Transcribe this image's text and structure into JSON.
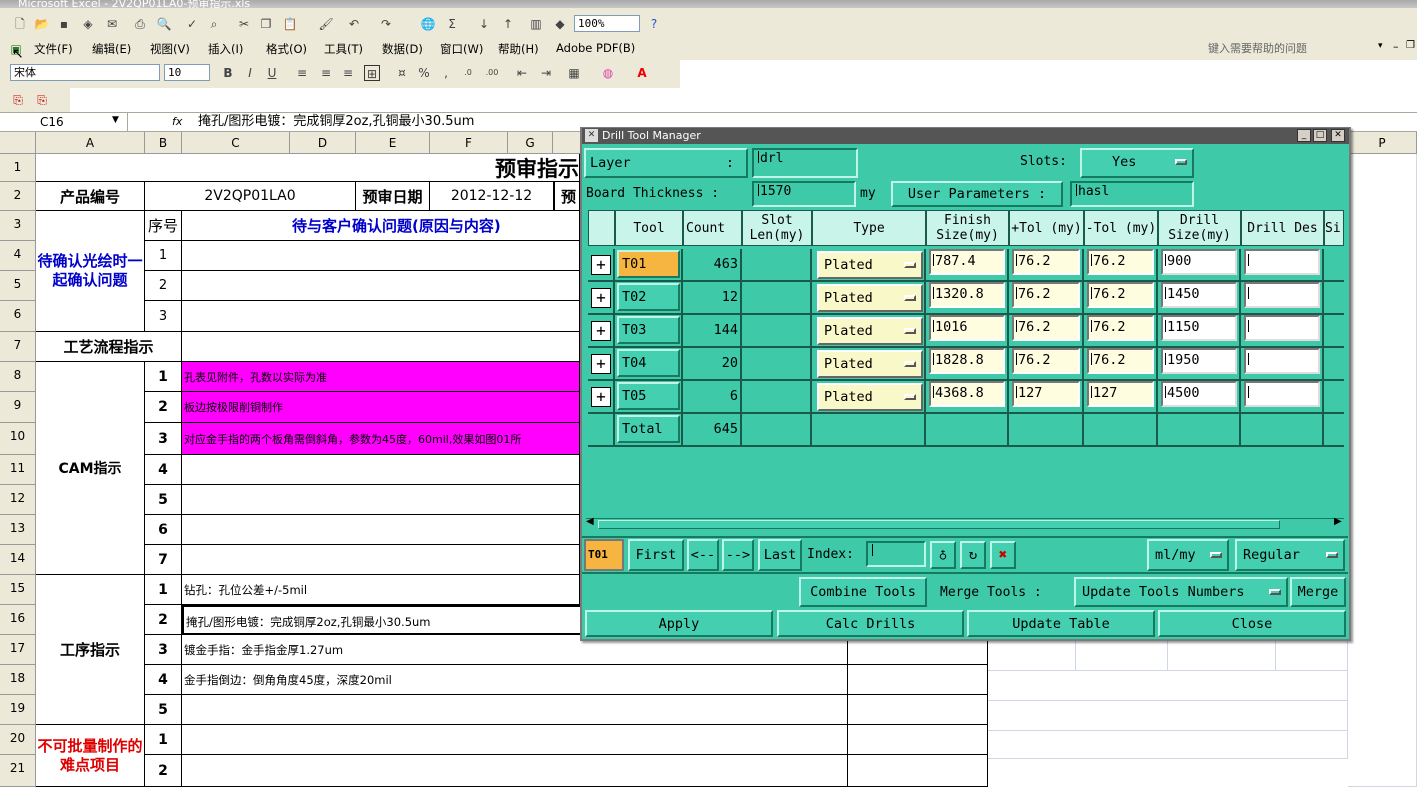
{
  "window_title": "Microsoft Excel - 2V2QP01LA0-预审指示.xls",
  "menu": [
    "文件(F)",
    "编辑(E)",
    "视图(V)",
    "插入(I)",
    "格式(O)",
    "工具(T)",
    "数据(D)",
    "窗口(W)",
    "帮助(H)",
    "Adobe PDF(B)"
  ],
  "help_placeholder": "键入需要帮助的问题",
  "zoom": "100%",
  "font_name": "宋体",
  "font_size": "10",
  "name_box": "C16",
  "fx_label": "fx",
  "formula": "掩孔/图形电镀：完成铜厚2oz,孔铜最小30.5um",
  "columns": [
    "A",
    "B",
    "C",
    "D",
    "E",
    "F",
    "G",
    "P"
  ],
  "rows": [
    "1",
    "2",
    "3",
    "4",
    "5",
    "6",
    "7",
    "8",
    "9",
    "10",
    "11",
    "12",
    "13",
    "14",
    "15",
    "16",
    "17",
    "18",
    "19",
    "20",
    "21"
  ],
  "sheet": {
    "title": "预审指示",
    "product_label": "产品编号",
    "product_value": "2V2QP01LA0",
    "date_label": "预审日期",
    "date_value": "2012-12-12",
    "date_trail": "预",
    "confirm_section": "待确认光绘时一起确认问题",
    "seq_header": "序号",
    "issue_header": "待与客户确认问题(原因与内容)",
    "flow_header": "工艺流程指示",
    "cam_label": "CAM指示",
    "cam_items": [
      "孔表见附件，孔数以实际为准",
      "板边按极限削铜制作",
      "对应金手指的两个板角需倒斜角，参数为45度，60mil,效果如图01所"
    ],
    "proc_label": "工序指示",
    "proc_items": [
      "钻孔：孔位公差+/-5mil",
      "掩孔/图形电镀：完成铜厚2oz,孔铜最小30.5um",
      "镀金手指：金手指金厚1.27um",
      "金手指倒边：倒角角度45度，深度20mil",
      ""
    ],
    "hard_label": "不可批量制作的难点项目",
    "nums7": [
      "1",
      "2",
      "3",
      "4",
      "5",
      "6",
      "7"
    ],
    "nums5": [
      "1",
      "2",
      "3",
      "4",
      "5"
    ],
    "nums3": [
      "1",
      "2",
      "3"
    ],
    "nums2": [
      "1",
      "2"
    ]
  },
  "dialog": {
    "title": "Drill Tool Manager",
    "layer_label": "Layer",
    "layer_colon": ":",
    "layer_value": "drl",
    "slots_label": "Slots:",
    "slots_value": "Yes",
    "thickness_label": "Board Thickness :",
    "thickness_value": "1570",
    "thickness_unit": "my",
    "user_params_label": "User Parameters :",
    "user_params_value": "hasl",
    "headers": [
      "Tool",
      "Count",
      "Slot Len(my)",
      "Type",
      "Finish Size(my)",
      "+Tol (my)",
      "-Tol (my)",
      "Drill Size(my)",
      "Drill Des",
      "Si"
    ],
    "tools": [
      {
        "name": "T01",
        "count": "463",
        "type": "Plated",
        "finish": "787.4",
        "ptol": "76.2",
        "mtol": "76.2",
        "drill": "900",
        "des": ""
      },
      {
        "name": "T02",
        "count": "12",
        "type": "Plated",
        "finish": "1320.8",
        "ptol": "76.2",
        "mtol": "76.2",
        "drill": "1450",
        "des": ""
      },
      {
        "name": "T03",
        "count": "144",
        "type": "Plated",
        "finish": "1016",
        "ptol": "76.2",
        "mtol": "76.2",
        "drill": "1150",
        "des": ""
      },
      {
        "name": "T04",
        "count": "20",
        "type": "Plated",
        "finish": "1828.8",
        "ptol": "76.2",
        "mtol": "76.2",
        "drill": "1950",
        "des": ""
      },
      {
        "name": "T05",
        "count": "6",
        "type": "Plated",
        "finish": "4368.8",
        "ptol": "127",
        "mtol": "127",
        "drill": "4500",
        "des": ""
      }
    ],
    "total_label": "Total",
    "total_count": "645",
    "current_tool": "T01",
    "nav": {
      "first": "First",
      "prev": "<--",
      "next": "-->",
      "last": "Last",
      "index_label": "Index:",
      "index_value": ""
    },
    "units_value": "ml/my",
    "mode_value": "Regular",
    "combine": "Combine Tools",
    "merge_label": "Merge Tools :",
    "merge_option": "Update Tools Numbers",
    "merge": "Merge",
    "apply": "Apply",
    "calc": "Calc Drills",
    "update": "Update Table",
    "close": "Close"
  },
  "colors": {
    "dialog_bg": "#3ecaa9",
    "magenta": "#ff00ff",
    "selected_tool": "#f6b540",
    "section_blue": "#0000cc",
    "section_red": "#e00000"
  }
}
